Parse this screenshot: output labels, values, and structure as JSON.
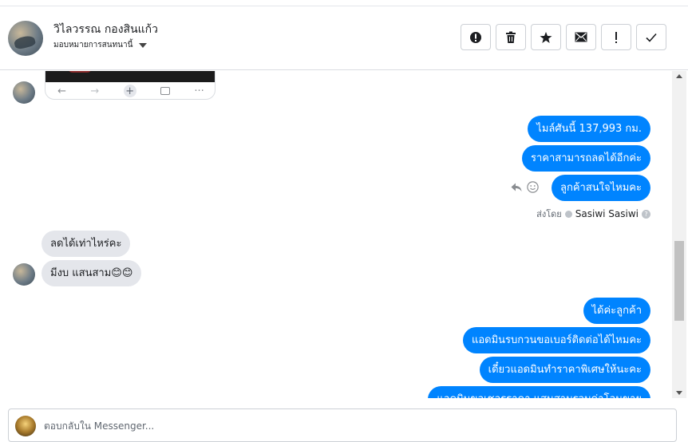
{
  "header": {
    "contact_name": "วิไลวรรณ กองสินแก้ว",
    "assign_label": "มอบหมายการสนทนานี้"
  },
  "actions": [
    {
      "name": "mark-spam-button",
      "icon": "alert-circle-icon"
    },
    {
      "name": "delete-button",
      "icon": "trash-icon"
    },
    {
      "name": "star-button",
      "icon": "star-icon"
    },
    {
      "name": "mark-unread-button",
      "icon": "envelope-icon"
    },
    {
      "name": "follow-up-button",
      "icon": "exclamation-icon"
    },
    {
      "name": "mark-done-button",
      "icon": "checkmark-icon"
    }
  ],
  "messages": {
    "out_1": "ไมล์ศันนี้ 137,993 กม.",
    "out_2": "ราคาสามารถลดได้อีกค่ะ",
    "out_3": "ลูกค้าสนใจไหมคะ",
    "in_1": "ลดได้เท่าไหร่คะ",
    "in_2": "มีงบ แสนสาม😊😊",
    "out_4": "ได้ค่ะลูกค้า",
    "out_5": "แอดมินรบกวนขอเบอร์ติดต่อได้ไหมคะ",
    "out_6": "เดี๋ยวแอดมินทำราคาพิเศษให้นะคะ",
    "out_7": "แอดมินขอเชอรราคา แสนสามรวมค่าโอนขาย"
  },
  "sent_by": {
    "prefix": "ส่งโดย",
    "name": "Sasiwi Sasiwi"
  },
  "composer": {
    "placeholder": "ตอบกลับใน Messenger..."
  },
  "colors": {
    "outgoing_bubble": "#0084ff",
    "incoming_bubble": "#e4e6eb"
  }
}
